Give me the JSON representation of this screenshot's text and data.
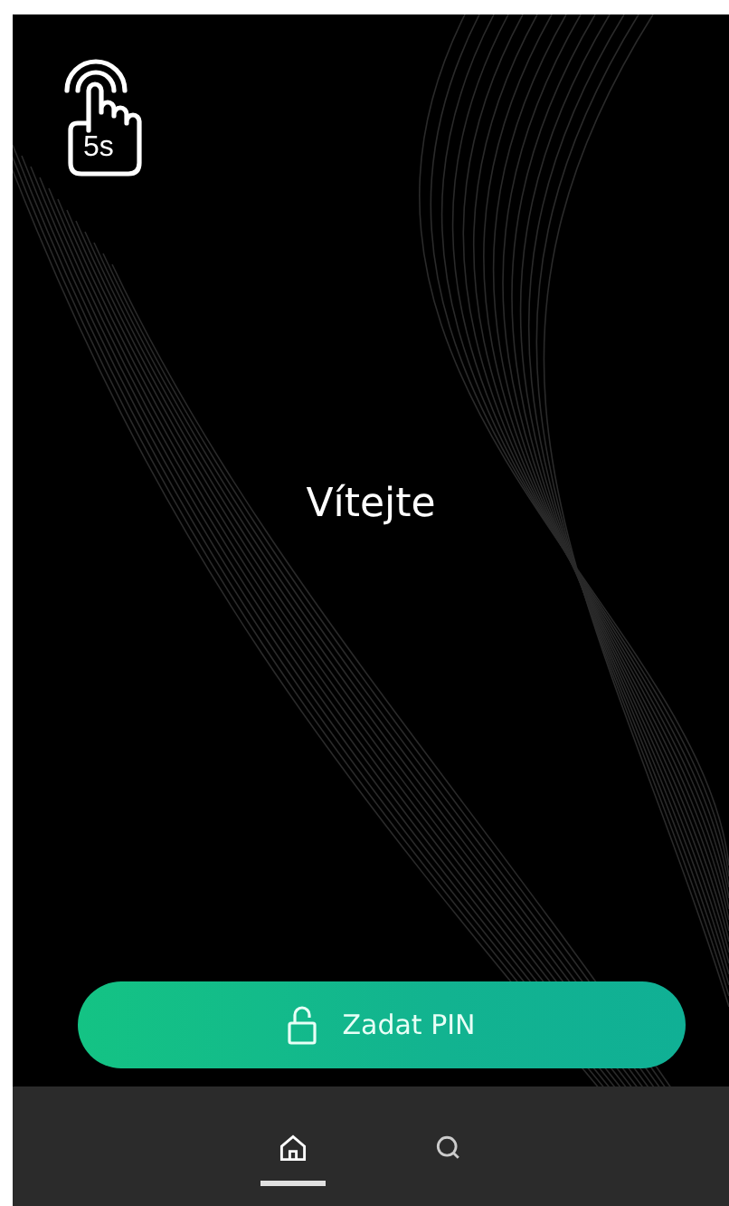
{
  "hold_hint": {
    "label": "5s"
  },
  "welcome": {
    "title": "Vítejte"
  },
  "pin_button": {
    "label": "Zadat PIN"
  },
  "nav_items": [
    {
      "kind": "home",
      "selected": true
    },
    {
      "kind": "search",
      "selected": false
    }
  ]
}
